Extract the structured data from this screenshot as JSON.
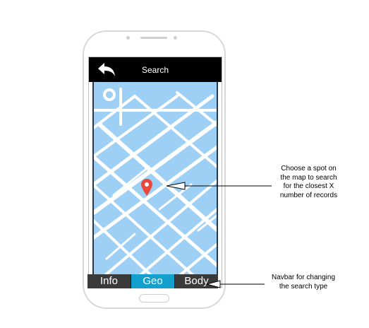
{
  "header": {
    "title": "Search",
    "back_icon": "back-arrow-icon"
  },
  "map": {
    "marker_icon": "map-pin-icon",
    "marker_color": "#e9473c",
    "water_color": "#9ed0f5"
  },
  "navbar": {
    "items": [
      {
        "label": "Info",
        "active": false
      },
      {
        "label": "Geo",
        "active": true
      },
      {
        "label": "Body",
        "active": false
      }
    ],
    "active_color": "#14a0cc",
    "inactive_color": "#3a3a3a"
  },
  "annotations": {
    "map_note": [
      "Choose a spot on",
      "the map to search",
      "for the closest X",
      "number of records"
    ],
    "navbar_note": [
      "Navbar for changing",
      "the search type"
    ]
  }
}
